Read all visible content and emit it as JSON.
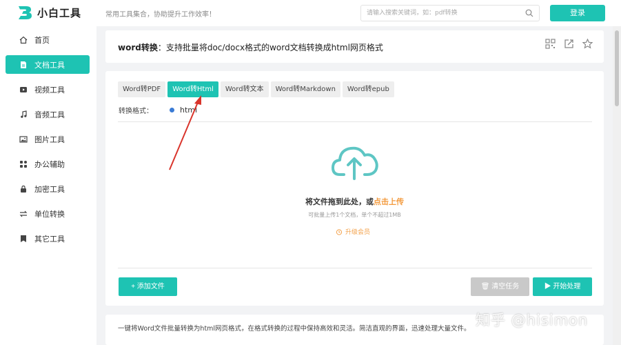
{
  "brand": {
    "name": "小白工具",
    "slogan": "常用工具集合，协助提升工作效率！",
    "accent": "#1ec3b3"
  },
  "search": {
    "placeholder": "请输入搜索关键词，如：pdf转换"
  },
  "header": {
    "login_label": "登录"
  },
  "sidebar": {
    "items": [
      {
        "label": "首页",
        "icon": "home-icon"
      },
      {
        "label": "文档工具",
        "icon": "document-icon",
        "active": true
      },
      {
        "label": "视频工具",
        "icon": "video-icon"
      },
      {
        "label": "音频工具",
        "icon": "music-icon"
      },
      {
        "label": "图片工具",
        "icon": "image-icon"
      },
      {
        "label": "办公辅助",
        "icon": "office-icon"
      },
      {
        "label": "加密工具",
        "icon": "lock-icon"
      },
      {
        "label": "单位转换",
        "icon": "convert-icon"
      },
      {
        "label": "其它工具",
        "icon": "bookmark-icon"
      }
    ]
  },
  "page": {
    "title_bold": "word转换",
    "title_rest": "：支持批量将doc/docx格式的word文档转换成html网页格式"
  },
  "tabs": [
    {
      "label": "Word转PDF"
    },
    {
      "label": "Word转Html",
      "active": true
    },
    {
      "label": "Word转文本"
    },
    {
      "label": "Word转Markdown"
    },
    {
      "label": "Word转epub"
    }
  ],
  "format": {
    "label": "转换格式：",
    "option": "html"
  },
  "upload": {
    "main_text": "将文件拖到此处，或",
    "link_text": "点击上传",
    "sub_text": "可批量上传1个文档，单个不超过1MB",
    "upgrade_label": "升级会员"
  },
  "buttons": {
    "add_file": "+ 添加文件",
    "clear": "清空任务",
    "start": "开始处理"
  },
  "description": "一键将Word文件批量转换为html网页格式，在格式转换的过程中保持高效和灵活。简洁直观的界面，迅速处理大量文件。",
  "watermark": "知乎 @hisimon"
}
